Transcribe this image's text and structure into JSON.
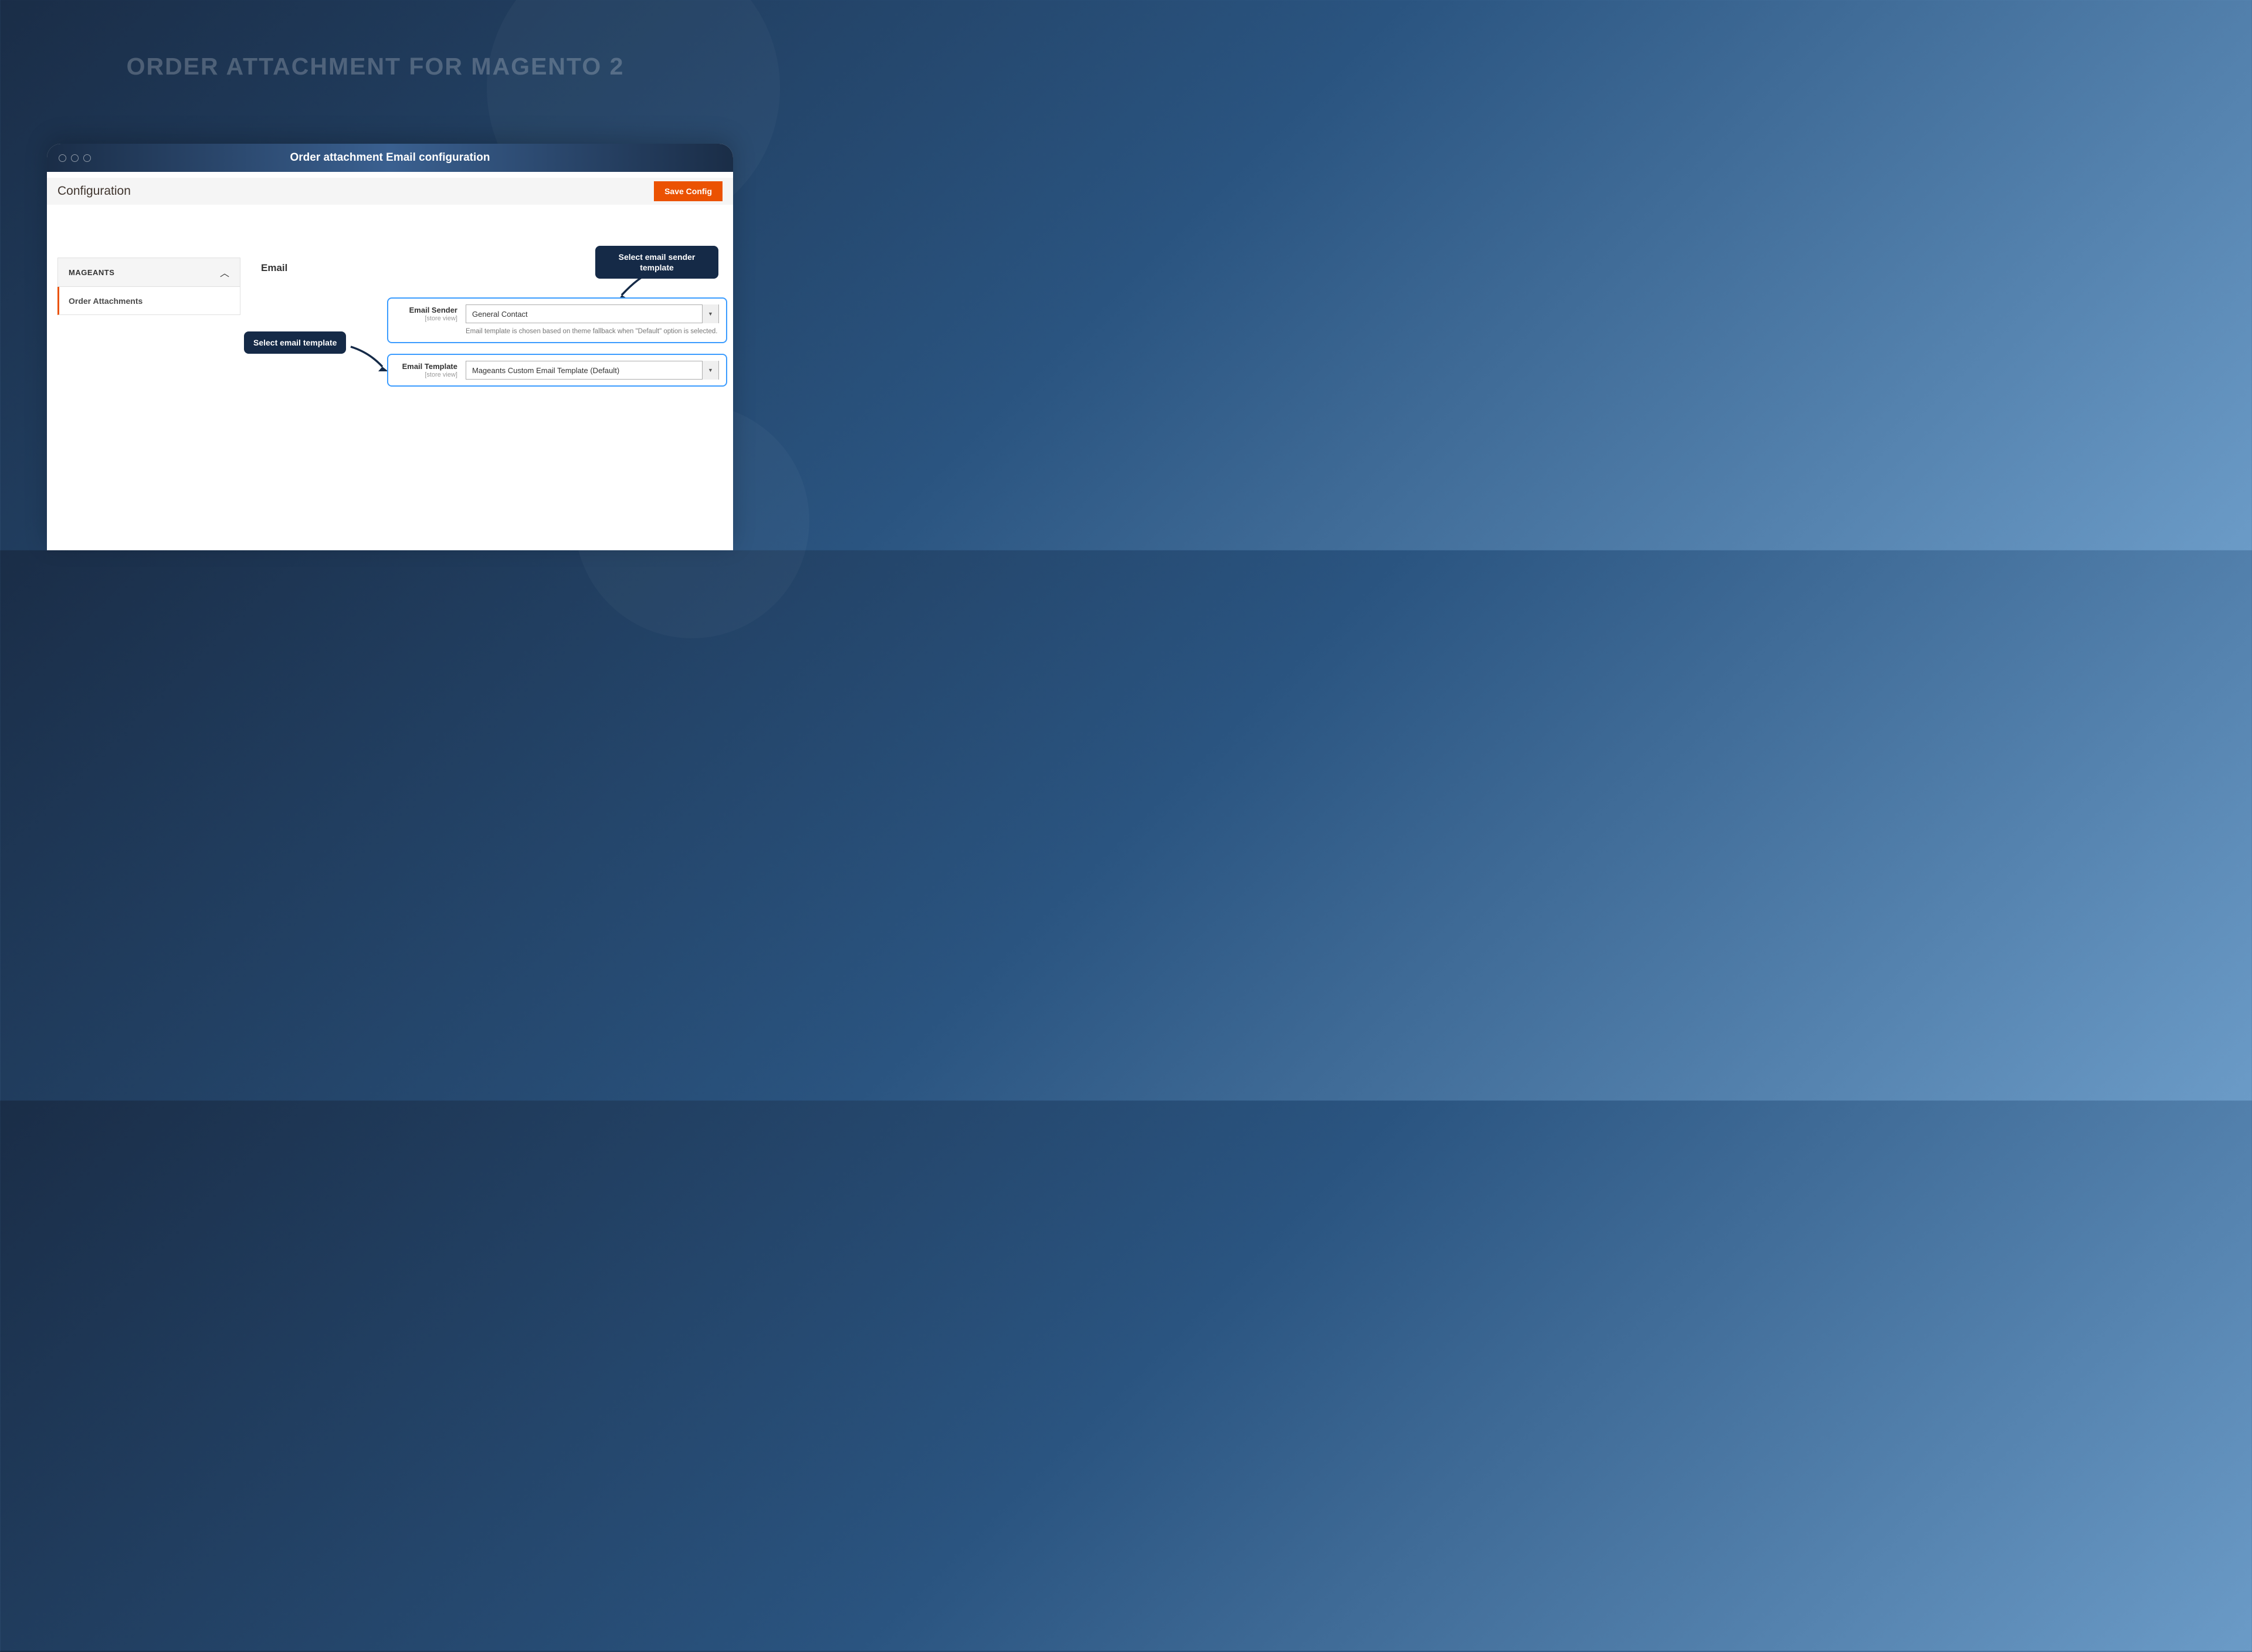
{
  "hero": {
    "title": "ORDER ATTACHMENT FOR MAGENTO 2"
  },
  "titlebar": {
    "text": "Order attachment Email configuration"
  },
  "header": {
    "title": "Configuration",
    "save_label": "Save Config"
  },
  "sidebar": {
    "section_label": "MAGEANTS",
    "item_label": "Order Attachments"
  },
  "section": {
    "heading": "Email"
  },
  "fields": {
    "sender": {
      "label": "Email Sender",
      "scope": "[store view]",
      "value": "General Contact",
      "help": "Email template is chosen based on theme fallback when \"Default\" option is selected."
    },
    "template": {
      "label": "Email Template",
      "scope": "[store view]",
      "value": "Mageants Custom Email Template (Default)"
    }
  },
  "callouts": {
    "sender": "Select email sender template",
    "template": "Select email template"
  }
}
